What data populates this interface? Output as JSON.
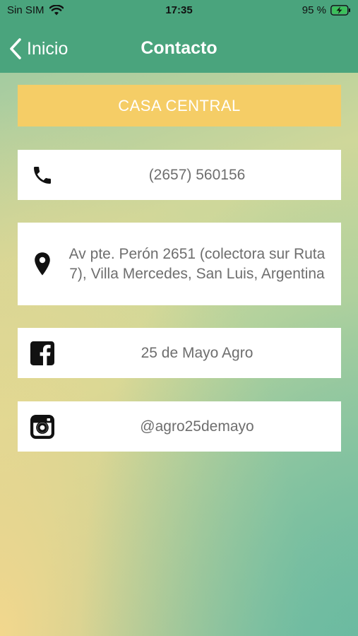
{
  "status_bar": {
    "carrier": "Sin SIM",
    "time": "17:35",
    "battery_percent": "95 %",
    "icons": [
      "wifi-icon",
      "battery-charging-icon"
    ]
  },
  "nav": {
    "back_label": "Inicio",
    "title": "Contacto",
    "icons": [
      "chevron-left-icon"
    ]
  },
  "header": {
    "label": "CASA CENTRAL"
  },
  "contacts": {
    "phone": {
      "icon": "phone-icon",
      "text": "(2657) 560156"
    },
    "address": {
      "icon": "location-pin-icon",
      "text": "Av pte. Perón 2651 (colectora sur Ruta 7), Villa Mercedes, San Luis, Argentina"
    },
    "facebook": {
      "icon": "facebook-icon",
      "text": "25 de Mayo Agro"
    },
    "instagram": {
      "icon": "instagram-icon",
      "text": "@agro25demayo"
    }
  },
  "colors": {
    "nav_bar": "#4aa47d",
    "header_banner": "#f5cd66",
    "card_background": "#ffffff",
    "card_text": "#6e6e6e"
  }
}
